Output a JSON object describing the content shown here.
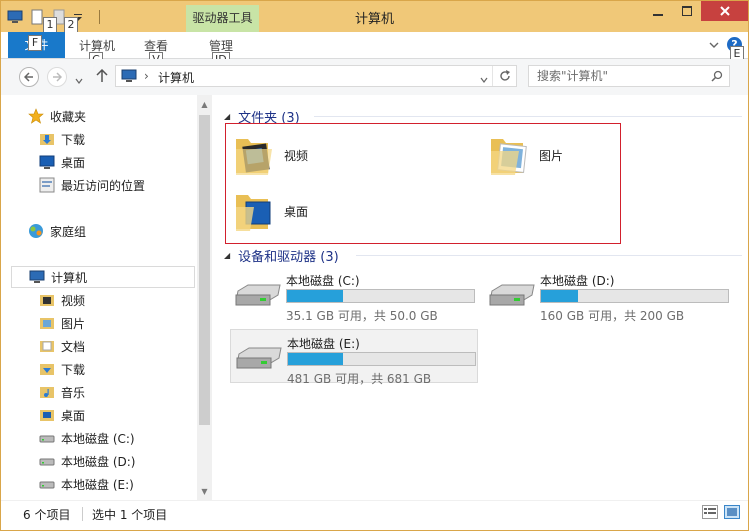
{
  "window": {
    "title": "计算机"
  },
  "qat": {
    "keytip_1": "1",
    "keytip_2": "2"
  },
  "ribbon": {
    "context_tab": "驱动器工具",
    "file_tab": "文件",
    "file_keytip": "F",
    "tabs": [
      {
        "label": "计算机",
        "keytip": "C"
      },
      {
        "label": "查看",
        "keytip": "V"
      },
      {
        "label": "管理",
        "keytip": "JD"
      }
    ],
    "help_keytip": "E",
    "help_label": "?"
  },
  "address": {
    "path": "计算机",
    "separator": "›"
  },
  "search": {
    "placeholder": "搜索\"计算机\""
  },
  "nav": {
    "favorites": "收藏夹",
    "favorite_items": [
      "下载",
      "桌面",
      "最近访问的位置"
    ],
    "homegroup": "家庭组",
    "computer": "计算机",
    "computer_items": [
      "视频",
      "图片",
      "文档",
      "下载",
      "音乐",
      "桌面",
      "本地磁盘 (C:)",
      "本地磁盘 (D:)",
      "本地磁盘 (E:)"
    ]
  },
  "groups": {
    "folders": {
      "header": "文件夹 (3)",
      "items": [
        "视频",
        "图片",
        "桌面"
      ]
    },
    "drives": {
      "header": "设备和驱动器 (3)",
      "items": [
        {
          "name": "本地磁盘 (C:)",
          "free": "35.1 GB 可用，共 50.0 GB",
          "used_fraction": 0.298
        },
        {
          "name": "本地磁盘 (D:)",
          "free": "160 GB 可用，共 200 GB",
          "used_fraction": 0.2
        },
        {
          "name": "本地磁盘 (E:)",
          "free": "481 GB 可用，共 681 GB",
          "used_fraction": 0.294
        }
      ]
    }
  },
  "status": {
    "count": "6 个项目",
    "selected": "选中 1 个项目"
  },
  "colors": {
    "accent": "#1979ca",
    "drive_fill": "#26a0da",
    "title_bg": "#f0c878",
    "close": "#c7413f",
    "highlight": "#d2202d"
  }
}
